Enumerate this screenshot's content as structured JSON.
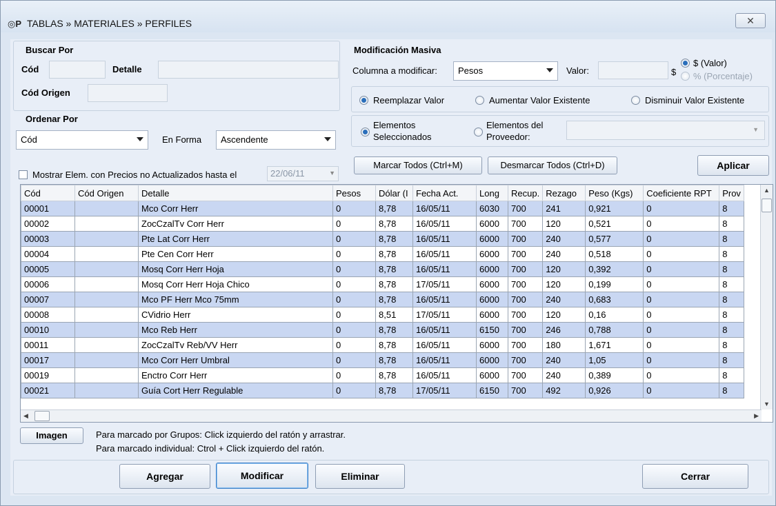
{
  "window": {
    "title": "TABLAS » MATERIALES » PERFILES",
    "close_glyph": "✕"
  },
  "search": {
    "header": "Buscar Por",
    "cod_label": "Cód",
    "detalle_label": "Detalle",
    "cod_origen_label": "Cód Origen",
    "cod_value": "",
    "detalle_value": "",
    "cod_origen_value": ""
  },
  "order": {
    "header": "Ordenar Por",
    "field_value": "Cód",
    "en_forma_label": "En Forma",
    "direction_value": "Ascendente"
  },
  "filter": {
    "checkbox_label": "Mostrar Elem. con Precios no Actualizados hasta el",
    "checked": false,
    "date_value": "22/06/11"
  },
  "mass": {
    "header": "Modificación Masiva",
    "column_label": "Columna a modificar:",
    "column_value": "Pesos",
    "valor_label": "Valor:",
    "valor_value": "",
    "currency_symbol": "$",
    "opt_valor": "$ (Valor)",
    "opt_porcentaje": "% (Porcentaje)",
    "opt_reemplazar": "Reemplazar Valor",
    "opt_aumentar": "Aumentar Valor Existente",
    "opt_disminuir": "Disminuir Valor Existente",
    "opt_seleccionados_1": "Elementos",
    "opt_seleccionados_2": "Seleccionados",
    "opt_proveedor_1": "Elementos del",
    "opt_proveedor_2": "Proveedor:",
    "proveedor_value": "",
    "marcar_todos": "Marcar Todos (Ctrl+M)",
    "desmarcar_todos": "Desmarcar Todos (Ctrl+D)",
    "aplicar": "Aplicar"
  },
  "grid": {
    "columns": [
      "Cód",
      "Cód Origen",
      "Detalle",
      "Pesos",
      "Dólar (I",
      "Fecha Act.",
      "Long",
      "Recup.",
      "Rezago",
      "Peso (Kgs)",
      "Coeficiente RPT",
      "Prov"
    ],
    "rows": [
      [
        "00001",
        "",
        "Mco Corr Herr",
        "0",
        "8,78",
        "16/05/11",
        "6030",
        "700",
        "241",
        "0,921",
        "0",
        "8"
      ],
      [
        "00002",
        "",
        "ZocCzalTv Corr Herr",
        "0",
        "8,78",
        "16/05/11",
        "6000",
        "700",
        "120",
        "0,521",
        "0",
        "8"
      ],
      [
        "00003",
        "",
        "Pte Lat Corr Herr",
        "0",
        "8,78",
        "16/05/11",
        "6000",
        "700",
        "240",
        "0,577",
        "0",
        "8"
      ],
      [
        "00004",
        "",
        "Pte Cen Corr Herr",
        "0",
        "8,78",
        "16/05/11",
        "6000",
        "700",
        "240",
        "0,518",
        "0",
        "8"
      ],
      [
        "00005",
        "",
        "Mosq Corr Herr Hoja",
        "0",
        "8,78",
        "16/05/11",
        "6000",
        "700",
        "120",
        "0,392",
        "0",
        "8"
      ],
      [
        "00006",
        "",
        "Mosq Corr Herr Hoja Chico",
        "0",
        "8,78",
        "17/05/11",
        "6000",
        "700",
        "120",
        "0,199",
        "0",
        "8"
      ],
      [
        "00007",
        "",
        "Mco PF Herr Mco 75mm",
        "0",
        "8,78",
        "16/05/11",
        "6000",
        "700",
        "240",
        "0,683",
        "0",
        "8"
      ],
      [
        "00008",
        "",
        "CVidrio Herr",
        "0",
        "8,51",
        "17/05/11",
        "6000",
        "700",
        "120",
        "0,16",
        "0",
        "8"
      ],
      [
        "00010",
        "",
        "Mco Reb Herr",
        "0",
        "8,78",
        "16/05/11",
        "6150",
        "700",
        "246",
        "0,788",
        "0",
        "8"
      ],
      [
        "00011",
        "",
        "ZocCzalTv Reb/VV Herr",
        "0",
        "8,78",
        "16/05/11",
        "6000",
        "700",
        "180",
        "1,671",
        "0",
        "8"
      ],
      [
        "00017",
        "",
        "Mco Corr Herr Umbral",
        "0",
        "8,78",
        "16/05/11",
        "6000",
        "700",
        "240",
        "1,05",
        "0",
        "8"
      ],
      [
        "00019",
        "",
        "Enctro Corr Herr",
        "0",
        "8,78",
        "16/05/11",
        "6000",
        "700",
        "240",
        "0,389",
        "0",
        "8"
      ],
      [
        "00021",
        "",
        "Guía Cort Herr Regulable",
        "0",
        "8,78",
        "17/05/11",
        "6150",
        "700",
        "492",
        "0,926",
        "0",
        "8"
      ]
    ]
  },
  "footer": {
    "imagen": "Imagen",
    "hint1": "Para marcado por Grupos: Click izquierdo del ratón y arrastrar.",
    "hint2": "Para marcado individual: Ctrol + Click izquierdo del ratón.",
    "agregar": "Agregar",
    "modificar": "Modificar",
    "eliminar": "Eliminar",
    "cerrar": "Cerrar"
  },
  "colors": {
    "selected_row": "#c9d7f2",
    "window_bg": "#dce6f2"
  }
}
